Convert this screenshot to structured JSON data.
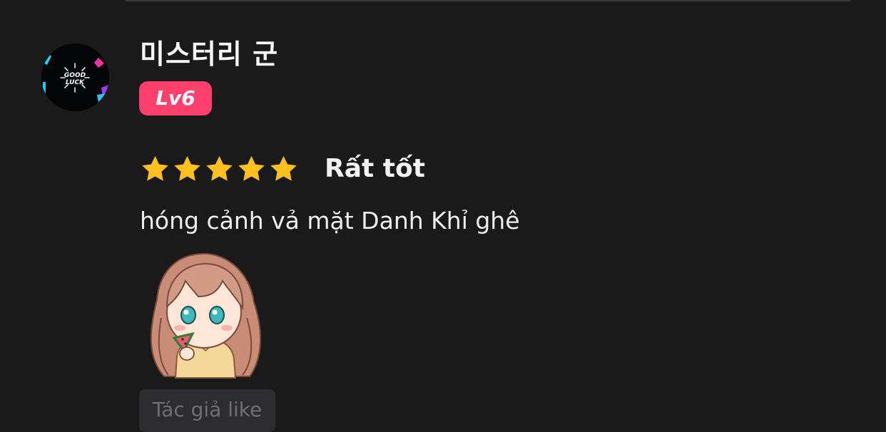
{
  "review": {
    "username": "미스터리 군",
    "level": "Lv6",
    "avatar": {
      "text_top": "GOOD",
      "text_bottom": "LUCK"
    },
    "rating": {
      "stars": 5,
      "max": 5,
      "label": "Rất tốt",
      "star_color": "#ffbf1f"
    },
    "text": "hóng cảnh vả mặt Danh Khỉ ghê",
    "sticker": "chibi-girl-eating-watermelon",
    "author_like": "Tác giả like"
  },
  "colors": {
    "background": "#1a1a1b",
    "level_badge": "#ff3f6c",
    "chip_bg": "#2d2d2f",
    "chip_text": "#6f6f72"
  }
}
